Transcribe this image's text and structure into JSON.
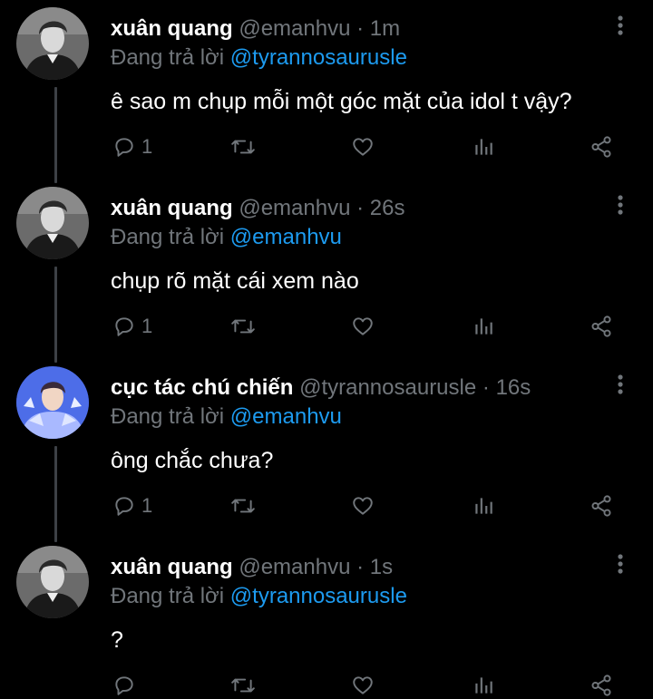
{
  "tweets": [
    {
      "name": "xuân quang",
      "handle": "@emanhvu",
      "time": "1m",
      "replying_prefix": "Đang trả lời",
      "replying_to": "@tyrannosaurusle",
      "text": "ê sao m chụp mỗi một góc mặt của idol t vậy?",
      "reply_count": "1",
      "avatar": "dark-portrait"
    },
    {
      "name": "xuân quang",
      "handle": "@emanhvu",
      "time": "26s",
      "replying_prefix": "Đang trả lời",
      "replying_to": "@emanhvu",
      "text": "chụp rõ mặt cái xem nào",
      "reply_count": "1",
      "avatar": "dark-portrait"
    },
    {
      "name": "cục tác chú chiến",
      "handle": "@tyrannosaurusle",
      "time": "16s",
      "replying_prefix": "Đang trả lời",
      "replying_to": "@emanhvu",
      "text": "ông chắc chưa?",
      "reply_count": "1",
      "avatar": "blue-portrait"
    },
    {
      "name": "xuân quang",
      "handle": "@emanhvu",
      "time": "1s",
      "replying_prefix": "Đang trả lời",
      "replying_to": "@tyrannosaurusle",
      "text": "?",
      "reply_count": "",
      "avatar": "dark-portrait"
    }
  ],
  "separator": "·",
  "icons": {
    "more": "more-vertical-icon",
    "reply": "reply-icon",
    "retweet": "retweet-icon",
    "like": "heart-icon",
    "stats": "stats-icon",
    "share": "share-icon"
  },
  "colors": {
    "background": "#000000",
    "name": "#ffffff",
    "meta": "#71767b",
    "mention": "#1d9bf0",
    "thread_line": "#3d4146"
  }
}
